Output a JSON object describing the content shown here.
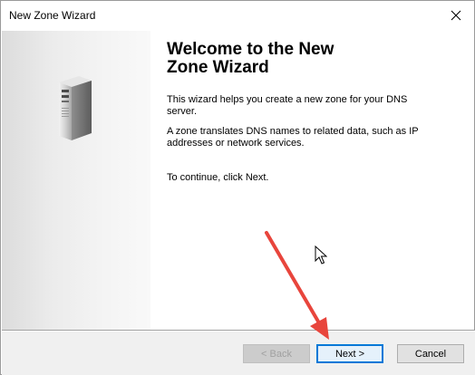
{
  "window": {
    "title": "New Zone Wizard",
    "close_glyph": "✕"
  },
  "content": {
    "heading": "Welcome to the New Zone Wizard",
    "paragraph1": "This wizard helps you create a new zone for your DNS server.",
    "paragraph2": "A zone translates DNS names to related data, such as IP addresses or network services.",
    "paragraph3": "To continue, click Next."
  },
  "buttons": {
    "back": "< Back",
    "next": "Next >",
    "cancel": "Cancel"
  },
  "annotation": {
    "arrow_color": "#e8453c",
    "arrow_icon": "red-arrow-icon",
    "cursor_icon": "mouse-pointer-icon"
  },
  "accent_color": "#0078d7"
}
